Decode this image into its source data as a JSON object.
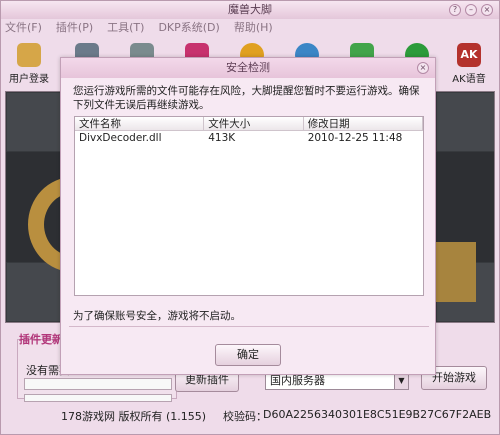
{
  "window": {
    "title": "魔兽大脚"
  },
  "menu": [
    "文件(F)",
    "插件(P)",
    "工具(T)",
    "DKP系统(D)",
    "帮助(H)"
  ],
  "toolbar": [
    {
      "label": "用户登录",
      "icon": "key-user-icon",
      "color": "#d6a648"
    },
    {
      "label": "",
      "icon": "tool-icon-2",
      "color": "#6b7a8a"
    },
    {
      "label": "",
      "icon": "tool-icon-3",
      "color": "#7a8b8e"
    },
    {
      "label": "",
      "icon": "tool-icon-4",
      "color": "#c7326e"
    },
    {
      "label": "",
      "icon": "tool-icon-5",
      "color": "#e0a020"
    },
    {
      "label": "",
      "icon": "globe-icon",
      "color": "#3b86c6"
    },
    {
      "label": "",
      "icon": "shield-icon",
      "color": "#42a44a"
    },
    {
      "label": "",
      "icon": "refresh-icon",
      "color": "#2c9b3a"
    },
    {
      "label": "AK语音",
      "icon": "ak-voice-icon",
      "color": "#b4322d"
    }
  ],
  "plugin_panel": {
    "title": "插件更新",
    "status_text": "没有需要",
    "update_button": "更新插件",
    "server_select": "国内服务器",
    "start_button": "开始游戏"
  },
  "status": {
    "copyright": "178游戏网 版权所有 (1.155)",
    "hash_label": "校验码：",
    "hash_value": "D60A2256340301E8C51E9B27C67F2AEB"
  },
  "dialog": {
    "title": "安全检测",
    "message": "您运行游戏所需的文件可能存在风险，大脚提醒您暂时不要运行游戏。确保下列文件无误后再继续游戏。",
    "columns": [
      "文件名称",
      "文件大小",
      "修改日期"
    ],
    "rows": [
      {
        "name": "DivxDecoder.dll",
        "size": "413K",
        "date": "2010-12-25 11:48"
      }
    ],
    "note": "为了确保账号安全，游戏将不启动。",
    "ok_button": "确定"
  }
}
